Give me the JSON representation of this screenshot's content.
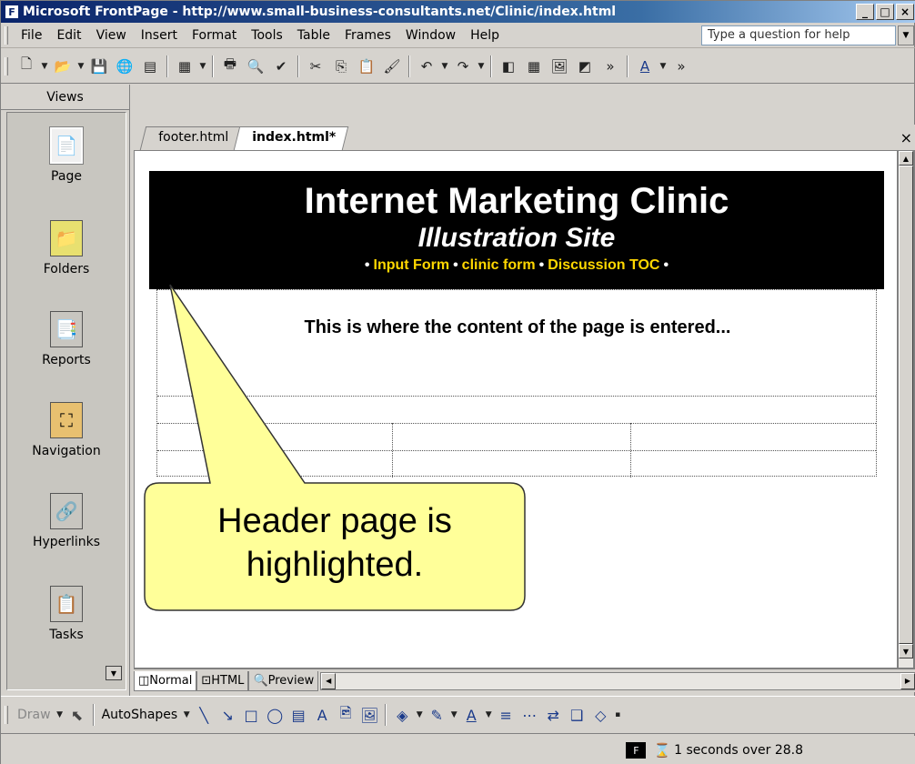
{
  "window": {
    "title": "Microsoft FrontPage - http://www.small-business-consultants.net/Clinic/index.html",
    "app_icon": "frontpage-icon",
    "minimize": "_",
    "maximize": "□",
    "close": "×"
  },
  "menubar": {
    "items": [
      "File",
      "Edit",
      "View",
      "Insert",
      "Format",
      "Tools",
      "Table",
      "Frames",
      "Window",
      "Help"
    ],
    "help_placeholder": "Type a question for help"
  },
  "views": {
    "header": "Views",
    "items": [
      {
        "label": "Page",
        "icon": "page-icon",
        "selected": true
      },
      {
        "label": "Folders",
        "icon": "folder-icon"
      },
      {
        "label": "Reports",
        "icon": "reports-icon"
      },
      {
        "label": "Navigation",
        "icon": "navigation-icon"
      },
      {
        "label": "Hyperlinks",
        "icon": "hyperlinks-icon"
      },
      {
        "label": "Tasks",
        "icon": "tasks-icon"
      }
    ]
  },
  "editor": {
    "tabs": [
      "footer.html",
      "index.html*"
    ],
    "active_tab": "index.html*",
    "close": "×"
  },
  "page": {
    "banner_title": "Internet Marketing Clinic",
    "banner_subtitle": "Illustration Site",
    "links": [
      "Input Form",
      "clinic form",
      "Discussion TOC"
    ],
    "bullet": "•",
    "content_text": "This is where the content of the page is entered..."
  },
  "callout": {
    "line1": "Header page is",
    "line2": "highlighted.",
    "fill": "#ffff99"
  },
  "view_tabs": [
    "Normal",
    "HTML",
    "Preview"
  ],
  "drawbar": {
    "draw": "Draw",
    "autoshapes": "AutoShapes"
  },
  "status": {
    "text": "1 seconds over 28.8"
  }
}
